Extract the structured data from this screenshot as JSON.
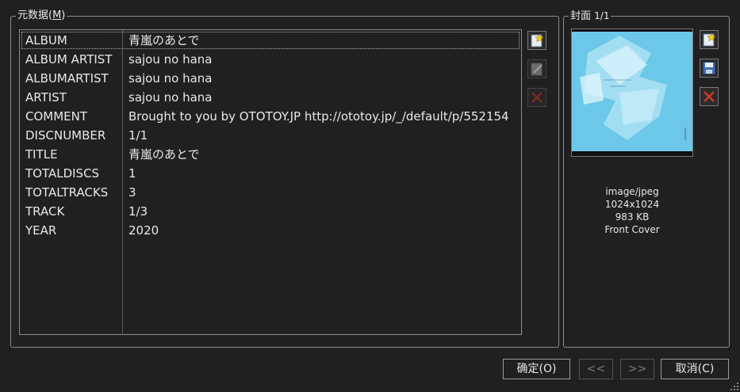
{
  "metadata": {
    "title": "元数据(",
    "mnemonic": "M",
    "title_end": ")",
    "rows": [
      {
        "key": "ALBUM",
        "value": "青嵐のあとで"
      },
      {
        "key": "ALBUM ARTIST",
        "value": "sajou no hana"
      },
      {
        "key": "ALBUMARTIST",
        "value": "sajou no hana"
      },
      {
        "key": "ARTIST",
        "value": "sajou no hana"
      },
      {
        "key": "COMMENT",
        "value": "Brought to you by OTOTOY.JP http://ototoy.jp/_/default/p/552154"
      },
      {
        "key": "DISCNUMBER",
        "value": "1/1"
      },
      {
        "key": "TITLE",
        "value": "青嵐のあとで"
      },
      {
        "key": "TOTALDISCS",
        "value": "1"
      },
      {
        "key": "TOTALTRACKS",
        "value": "3"
      },
      {
        "key": "TRACK",
        "value": "1/3"
      },
      {
        "key": "YEAR",
        "value": "2020"
      }
    ],
    "selected_row": 0,
    "tools": {
      "add": "add-star-icon",
      "edit": "edit-pencil-icon",
      "delete": "delete-x-icon"
    }
  },
  "cover": {
    "title": "封面",
    "counter": "1/1",
    "mime": "image/jpeg",
    "dimensions": "1024x1024",
    "size": "983 KB",
    "type": "Front Cover",
    "tools": {
      "add": "add-star-icon",
      "save": "save-disk-icon",
      "delete": "delete-x-icon"
    }
  },
  "buttons": {
    "ok": "确定(O)",
    "prev": "<<",
    "next": ">>",
    "cancel": "取消(C)"
  },
  "colors": {
    "background": "#202020",
    "border": "#8c8c8c",
    "delete_red": "#c0392b",
    "cover_blue": "#6cc8e8"
  }
}
